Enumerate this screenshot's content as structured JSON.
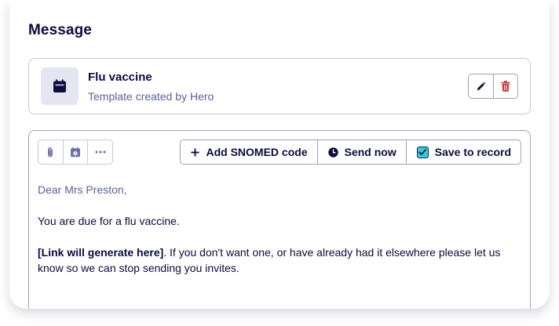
{
  "section_title": "Message",
  "template": {
    "name": "Flu vaccine",
    "subtitle": "Template created by Hero",
    "icon": "calendar-icon",
    "actions": [
      {
        "name": "edit",
        "icon": "pencil-icon"
      },
      {
        "name": "delete",
        "icon": "trash-icon"
      }
    ]
  },
  "toolbar": {
    "tools": [
      {
        "name": "attach",
        "icon": "paperclip-icon"
      },
      {
        "name": "schedule",
        "icon": "calendar-clock-icon"
      },
      {
        "name": "more",
        "icon": "ellipsis-icon"
      }
    ],
    "add_snomed_label": "Add SNOMED code",
    "send_now_label": "Send now",
    "save_to_record_label": "Save to record",
    "save_to_record_checked": true
  },
  "message": {
    "greeting": "Dear Mrs Preston,",
    "line1": "You are due for a flu vaccine.",
    "link_placeholder": "[Link will generate here]",
    "line2_rest": ". If you don't want one, or have already had it elsewhere please let us know so we can stop sending you invites."
  },
  "colors": {
    "primary_text": "#0b0c3f",
    "secondary_text": "#5a5f9e",
    "border": "#9ea1c8",
    "checkbox_fill": "#2fd0d8",
    "delete_red": "#d0312d"
  }
}
